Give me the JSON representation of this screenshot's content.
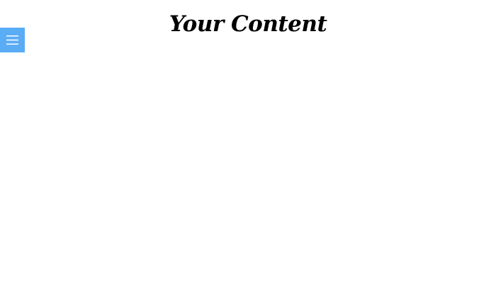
{
  "header": {
    "title": "Your Content"
  },
  "menu": {
    "icon": "hamburger-menu-icon",
    "background_color": "#5aacf5",
    "icon_color": "#ffffff"
  }
}
